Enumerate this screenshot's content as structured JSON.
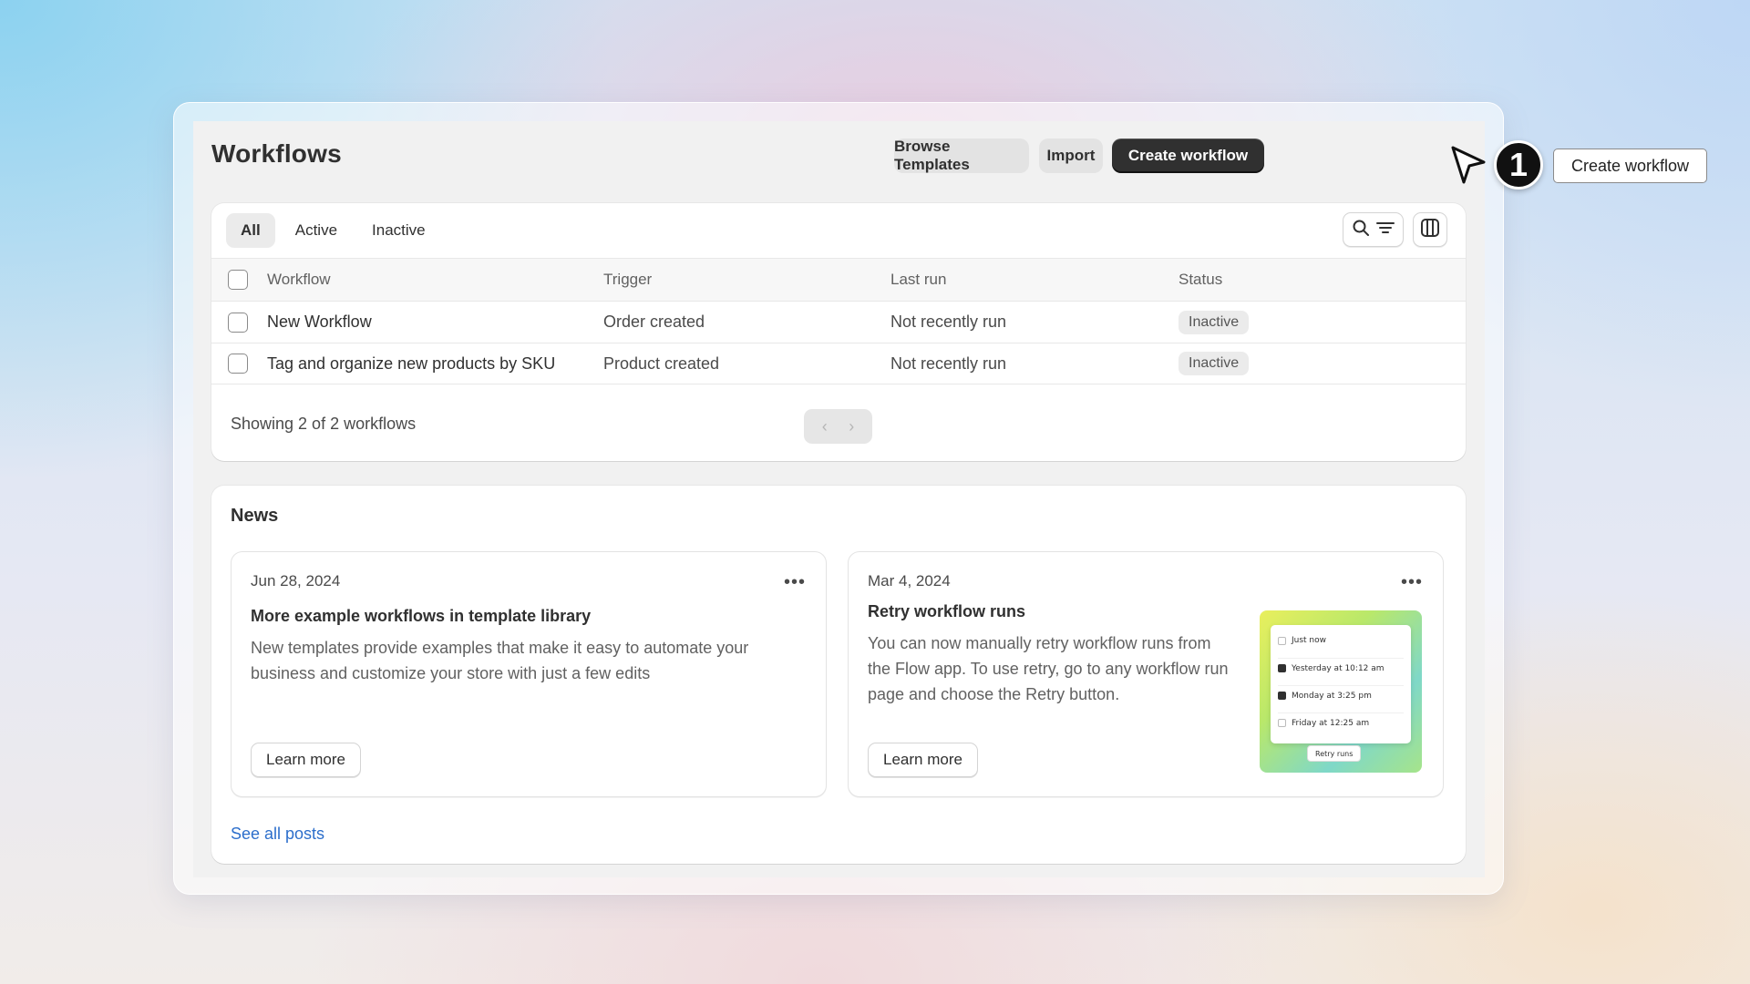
{
  "header": {
    "title": "Workflows",
    "browse_label": "Browse Templates",
    "import_label": "Import",
    "create_label": "Create workflow"
  },
  "tabs": [
    {
      "label": "All",
      "active": true
    },
    {
      "label": "Active",
      "active": false
    },
    {
      "label": "Inactive",
      "active": false
    }
  ],
  "icons": {
    "search": "search-icon",
    "filter": "filter-icon",
    "columns": "columns-icon",
    "prev": "chevron-left-icon",
    "next": "chevron-right-icon",
    "more": "more-horizontal-icon",
    "cursor": "mouse-pointer-icon"
  },
  "table": {
    "columns": [
      "Workflow",
      "Trigger",
      "Last run",
      "Status"
    ],
    "rows": [
      {
        "name": "New Workflow",
        "trigger": "Order created",
        "last_run": "Not recently run",
        "status": "Inactive"
      },
      {
        "name": "Tag and organize new products by SKU",
        "trigger": "Product created",
        "last_run": "Not recently run",
        "status": "Inactive"
      }
    ],
    "showing": "Showing 2 of 2 workflows"
  },
  "news": {
    "title": "News",
    "posts": [
      {
        "date": "Jun 28, 2024",
        "heading": "More example workflows in template library",
        "body": "New templates provide examples that make it easy to automate your business and customize your store with just a few edits",
        "button": "Learn more"
      },
      {
        "date": "Mar 4, 2024",
        "heading": "Retry workflow runs",
        "body": "You can now manually retry workflow runs from the Flow app. To use retry, go to any workflow run page and choose the Retry button.",
        "button": "Learn more",
        "thumbnail": {
          "items": [
            {
              "label": "Just now",
              "checked": false
            },
            {
              "label": "Yesterday at 10:12 am",
              "checked": true
            },
            {
              "label": "Monday at 3:25 pm",
              "checked": true
            },
            {
              "label": "Friday at 12:25 am",
              "checked": false
            }
          ],
          "button": "Retry runs"
        }
      }
    ],
    "see_all": "See all posts"
  },
  "annotation": {
    "step": "1",
    "label": "Create workflow"
  },
  "colors": {
    "primary_button": "#303030",
    "link": "#2c6ecb",
    "badge_bg": "#ebebeb"
  }
}
